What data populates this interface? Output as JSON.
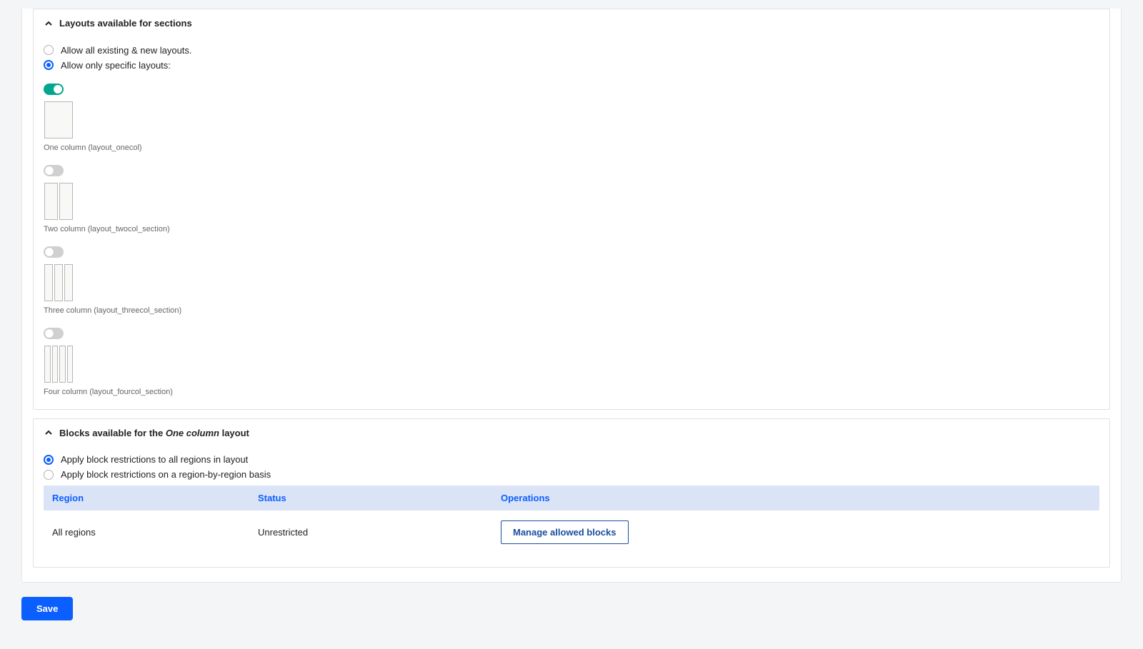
{
  "panels": {
    "layouts": {
      "title": "Layouts available for sections",
      "radios": {
        "allow_all": "Allow all existing & new layouts.",
        "allow_specific": "Allow only specific layouts:",
        "allow_all_selected": false,
        "allow_specific_selected": true
      },
      "items": [
        {
          "enabled": true,
          "cols": 1,
          "label": "One column (layout_onecol)"
        },
        {
          "enabled": false,
          "cols": 2,
          "label": "Two column (layout_twocol_section)"
        },
        {
          "enabled": false,
          "cols": 3,
          "label": "Three column (layout_threecol_section)"
        },
        {
          "enabled": false,
          "cols": 4,
          "label": "Four column (layout_fourcol_section)"
        }
      ]
    },
    "blocks": {
      "title_prefix": "Blocks available for the ",
      "title_em": "One column",
      "title_suffix": " layout",
      "radios": {
        "apply_all": "Apply block restrictions to all regions in layout",
        "apply_per_region": "Apply block restrictions on a region-by-region basis",
        "apply_all_selected": true,
        "apply_per_region_selected": false
      },
      "table": {
        "headers": {
          "region": "Region",
          "status": "Status",
          "operations": "Operations"
        },
        "rows": [
          {
            "region": "All regions",
            "status": "Unrestricted",
            "action": "Manage allowed blocks"
          }
        ]
      }
    }
  },
  "buttons": {
    "save": "Save"
  }
}
